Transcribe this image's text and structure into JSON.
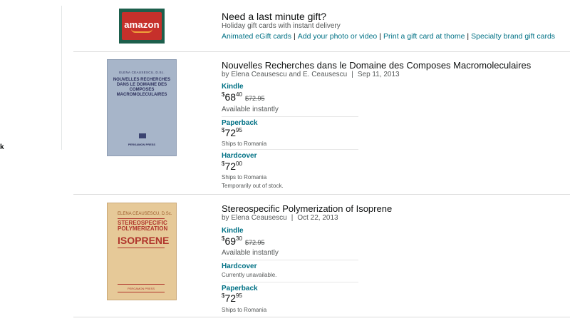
{
  "sidebar": {
    "truncated_label": "k"
  },
  "gift": {
    "logo_text": "amazon",
    "title": "Need a last minute gift?",
    "subtitle": "Holiday gift cards with instant delivery",
    "links": [
      "Animated eGift cards",
      "Add your photo or video",
      "Print a gift card at thome",
      "Specialty brand gift cards"
    ],
    "separator": "|"
  },
  "products": [
    {
      "title": "Nouvelles Recherches dans le Domaine des Composes Macromoleculaires",
      "byline": "by Elena Ceausescu and E. Ceausescu",
      "byline_sep": "|",
      "date": "Sep 11, 2013",
      "cover": {
        "author": "ELENA CEAUSESCU, D.Sc.",
        "title": "NOUVELLES RECHERCHES DANS LE DOMAINE DES COMPOSES MACROMOLECULAIRES",
        "publisher": "PERGAMON PRESS"
      },
      "formats": [
        {
          "name": "Kindle",
          "currency": "$",
          "whole": "68",
          "fraction": "40",
          "old_price": "$72.95",
          "notes": [
            "Available instantly"
          ]
        },
        {
          "name": "Paperback",
          "currency": "$",
          "whole": "72",
          "fraction": "95",
          "notes": [
            "Ships to Romania"
          ]
        },
        {
          "name": "Hardcover",
          "currency": "$",
          "whole": "72",
          "fraction": "00",
          "notes": [
            "Ships to Romania",
            "Temporarily out of stock."
          ]
        }
      ]
    },
    {
      "title": "Stereospecific Polymerization of Isoprene",
      "byline": "by Elena Ceausescu",
      "byline_sep": "|",
      "date": "Oct 22, 2013",
      "cover": {
        "author": "ELENA CEAUSESCU, D.Sc.",
        "title_small": "STEREOSPECIFIC POLYMERIZATION",
        "title_large": "ISOPRENE",
        "publisher": "PERGAMON PRESS"
      },
      "formats": [
        {
          "name": "Kindle",
          "currency": "$",
          "whole": "69",
          "fraction": "30",
          "old_price": "$72.95",
          "notes": [
            "Available instantly"
          ]
        },
        {
          "name": "Hardcover",
          "notes": [
            "Currently unavailable."
          ]
        },
        {
          "name": "Paperback",
          "currency": "$",
          "whole": "72",
          "fraction": "95",
          "notes": [
            "Ships to Romania"
          ]
        }
      ]
    }
  ]
}
